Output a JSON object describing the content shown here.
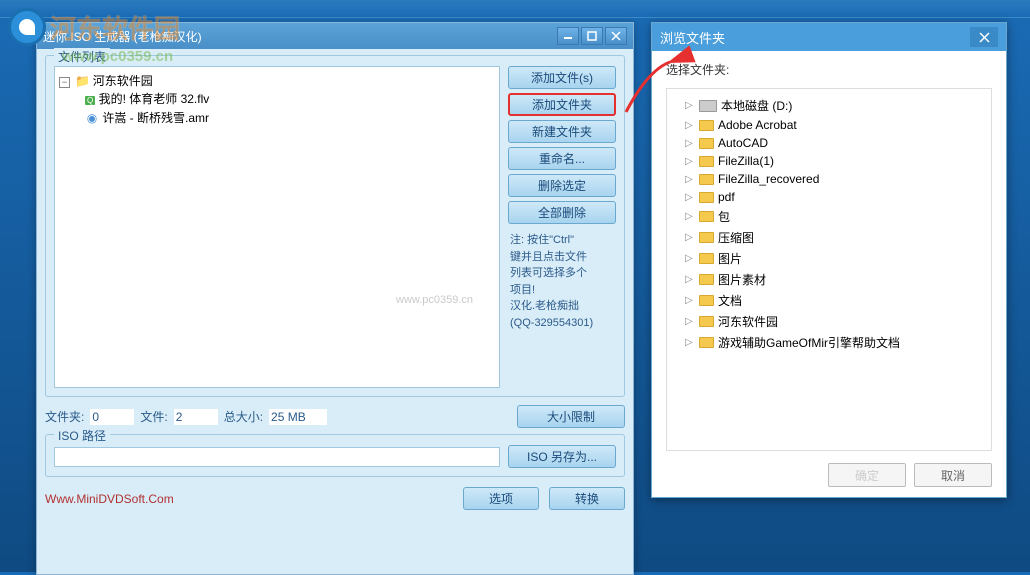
{
  "watermark": {
    "site_name": "河东软件园",
    "url": "www.pc0359.cn",
    "center": "www.pc0359.cn"
  },
  "main_window": {
    "title": "迷你 ISO 生成器 (老枪痴汉化)",
    "file_list_legend": "文件列表",
    "tree": {
      "root": "河东软件园",
      "items": [
        {
          "icon": "green",
          "label": "我的! 体育老师 32.flv"
        },
        {
          "icon": "blue",
          "label": "许嵩 - 断桥残雪.amr"
        }
      ]
    },
    "side_buttons": {
      "add_files": "添加文件(s)",
      "add_folder": "添加文件夹",
      "new_folder": "新建文件夹",
      "rename": "重命名...",
      "delete_selected": "删除选定",
      "delete_all": "全部删除"
    },
    "hint": "注: 按住\"Ctrl\"\n键并且点击文件\n列表可选择多个\n项目!\n汉化.老枪痴拙\n(QQ-329554301)",
    "stats": {
      "folders_label": "文件夹:",
      "folders_value": "0",
      "files_label": "文件:",
      "files_value": "2",
      "size_label": "总大小:",
      "size_value": "25 MB",
      "size_limit_btn": "大小限制"
    },
    "iso": {
      "legend": "ISO 路径",
      "save_btn": "ISO 另存为..."
    },
    "bottom": {
      "link": "Www.MiniDVDSoft.Com",
      "options": "选项",
      "convert": "转换"
    }
  },
  "browse_dialog": {
    "title": "浏览文件夹",
    "prompt": "选择文件夹:",
    "items": [
      {
        "type": "drive",
        "label": "本地磁盘 (D:)"
      },
      {
        "type": "folder",
        "label": "Adobe Acrobat"
      },
      {
        "type": "folder",
        "label": "AutoCAD"
      },
      {
        "type": "folder",
        "label": "FileZilla(1)"
      },
      {
        "type": "folder",
        "label": "FileZilla_recovered"
      },
      {
        "type": "folder",
        "label": "pdf"
      },
      {
        "type": "folder",
        "label": "包"
      },
      {
        "type": "folder",
        "label": "压缩图"
      },
      {
        "type": "folder",
        "label": "图片"
      },
      {
        "type": "folder",
        "label": "图片素材"
      },
      {
        "type": "folder",
        "label": "文档"
      },
      {
        "type": "folder",
        "label": "河东软件园"
      },
      {
        "type": "folder",
        "label": "游戏辅助GameOfMir引擎帮助文档"
      }
    ],
    "ok": "确定",
    "cancel": "取消"
  }
}
